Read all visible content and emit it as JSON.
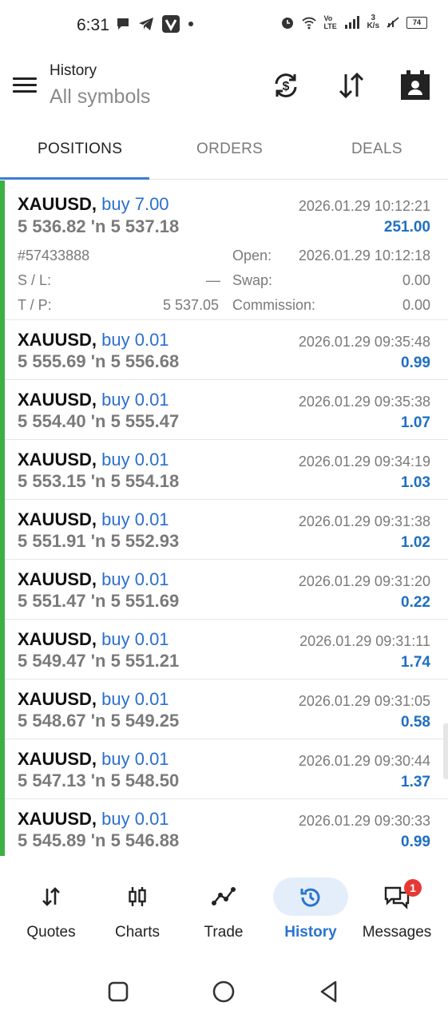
{
  "status_bar": {
    "time": "6:31",
    "network_label": "Vo LTE",
    "speed_value": "3",
    "speed_unit": "K/s",
    "battery": "74"
  },
  "app_bar": {
    "title": "History",
    "subtitle": "All symbols",
    "icons": [
      "menu-icon",
      "currency-exchange-icon",
      "sort-icon",
      "calendar-person-icon"
    ]
  },
  "tabs": [
    {
      "label": "POSITIONS",
      "active": true
    },
    {
      "label": "ORDERS",
      "active": false
    },
    {
      "label": "DEALS",
      "active": false
    }
  ],
  "colors": {
    "accent_green": "#3cb043",
    "buy_blue": "#2b6fcf",
    "profit_blue": "#1e6fc2",
    "tab_underline": "#3b7cd8",
    "badge_red": "#e53935"
  },
  "expanded_position": {
    "symbol": "XAUUSD,",
    "direction": "buy 7.00",
    "open_price": "5 536.82",
    "arrow": "'n",
    "close_price": "5 537.18",
    "time": "2026.01.29 10:12:21",
    "profit": "251.00",
    "ticket": "#57433888",
    "open_label": "Open:",
    "open_time": "2026.01.29 10:12:18",
    "sl_label": "S / L:",
    "sl_value": "—",
    "swap_label": "Swap:",
    "swap_value": "0.00",
    "tp_label": "T / P:",
    "tp_value": "5 537.05",
    "commission_label": "Commission:",
    "commission_value": "0.00"
  },
  "positions": [
    {
      "symbol": "XAUUSD,",
      "direction": "buy 0.01",
      "open_price": "5 555.69",
      "arrow": "'n",
      "close_price": "5 556.68",
      "time": "2026.01.29 09:35:48",
      "profit": "0.99"
    },
    {
      "symbol": "XAUUSD,",
      "direction": "buy 0.01",
      "open_price": "5 554.40",
      "arrow": "'n",
      "close_price": "5 555.47",
      "time": "2026.01.29 09:35:38",
      "profit": "1.07"
    },
    {
      "symbol": "XAUUSD,",
      "direction": "buy 0.01",
      "open_price": "5 553.15",
      "arrow": "'n",
      "close_price": "5 554.18",
      "time": "2026.01.29 09:34:19",
      "profit": "1.03"
    },
    {
      "symbol": "XAUUSD,",
      "direction": "buy 0.01",
      "open_price": "5 551.91",
      "arrow": "'n",
      "close_price": "5 552.93",
      "time": "2026.01.29 09:31:38",
      "profit": "1.02"
    },
    {
      "symbol": "XAUUSD,",
      "direction": "buy 0.01",
      "open_price": "5 551.47",
      "arrow": "'n",
      "close_price": "5 551.69",
      "time": "2026.01.29 09:31:20",
      "profit": "0.22"
    },
    {
      "symbol": "XAUUSD,",
      "direction": "buy 0.01",
      "open_price": "5 549.47",
      "arrow": "'n",
      "close_price": "5 551.21",
      "time": "2026.01.29 09:31:11",
      "profit": "1.74"
    },
    {
      "symbol": "XAUUSD,",
      "direction": "buy 0.01",
      "open_price": "5 548.67",
      "arrow": "'n",
      "close_price": "5 549.25",
      "time": "2026.01.29 09:31:05",
      "profit": "0.58"
    },
    {
      "symbol": "XAUUSD,",
      "direction": "buy 0.01",
      "open_price": "5 547.13",
      "arrow": "'n",
      "close_price": "5 548.50",
      "time": "2026.01.29 09:30:44",
      "profit": "1.37"
    },
    {
      "symbol": "XAUUSD,",
      "direction": "buy 0.01",
      "open_price": "5 545.89",
      "arrow": "'n",
      "close_price": "5 546.88",
      "time": "2026.01.29 09:30:33",
      "profit": "0.99"
    }
  ],
  "bottom_nav": [
    {
      "label": "Quotes",
      "icon": "quotes-arrows-icon",
      "active": false
    },
    {
      "label": "Charts",
      "icon": "candlestick-icon",
      "active": false
    },
    {
      "label": "Trade",
      "icon": "trade-line-icon",
      "active": false
    },
    {
      "label": "History",
      "icon": "history-clock-icon",
      "active": true
    },
    {
      "label": "Messages",
      "icon": "messages-icon",
      "active": false,
      "badge": "1"
    }
  ],
  "system_nav": [
    "recents-square-icon",
    "home-circle-icon",
    "back-triangle-icon"
  ]
}
